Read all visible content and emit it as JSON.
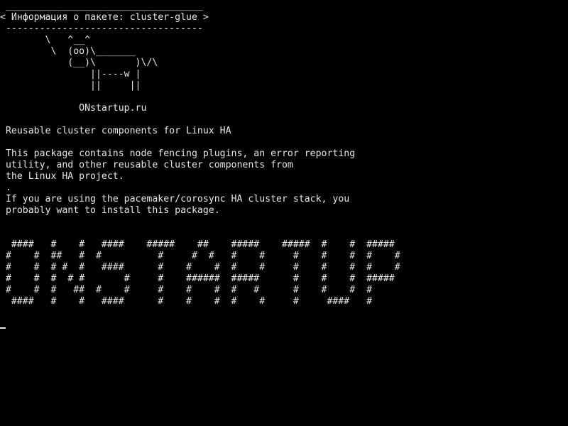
{
  "terminal": {
    "banner_top": " ___________________________________",
    "banner_title": "< Информация о пакете: cluster-glue >",
    "banner_bottom": " -----------------------------------",
    "cow": [
      "        \\   ^__^",
      "         \\  (oo)\\_______",
      "            (__)\\       )\\/\\",
      "                ||----w |",
      "                ||     ||"
    ],
    "site": "              ONstartup.ru",
    "summary": " Reusable cluster components for Linux HA",
    "description": [
      " This package contains node fencing plugins, an error reporting",
      " utility, and other reusable cluster components from",
      " the Linux HA project.",
      " .",
      " If you are using the pacemaker/corosync HA cluster stack, you",
      " probably want to install this package."
    ],
    "ascii_banner": [
      "  ####   #    #   ####    #####    ##    #####    #####  #    #  #####",
      " #    #  ##   #  #          #     #  #   #    #     #    #    #  #    #",
      " #    #  # #  #   ####      #    #    #  #    #     #    #    #  #    #",
      " #    #  #  # #       #     #    ######  #####      #    #    #  #####",
      " #    #  #   ##  #    #     #    #    #  #   #      #    #    #  #",
      "  ####   #    #   ####      #    #    #  #    #     #     ####   #"
    ]
  }
}
